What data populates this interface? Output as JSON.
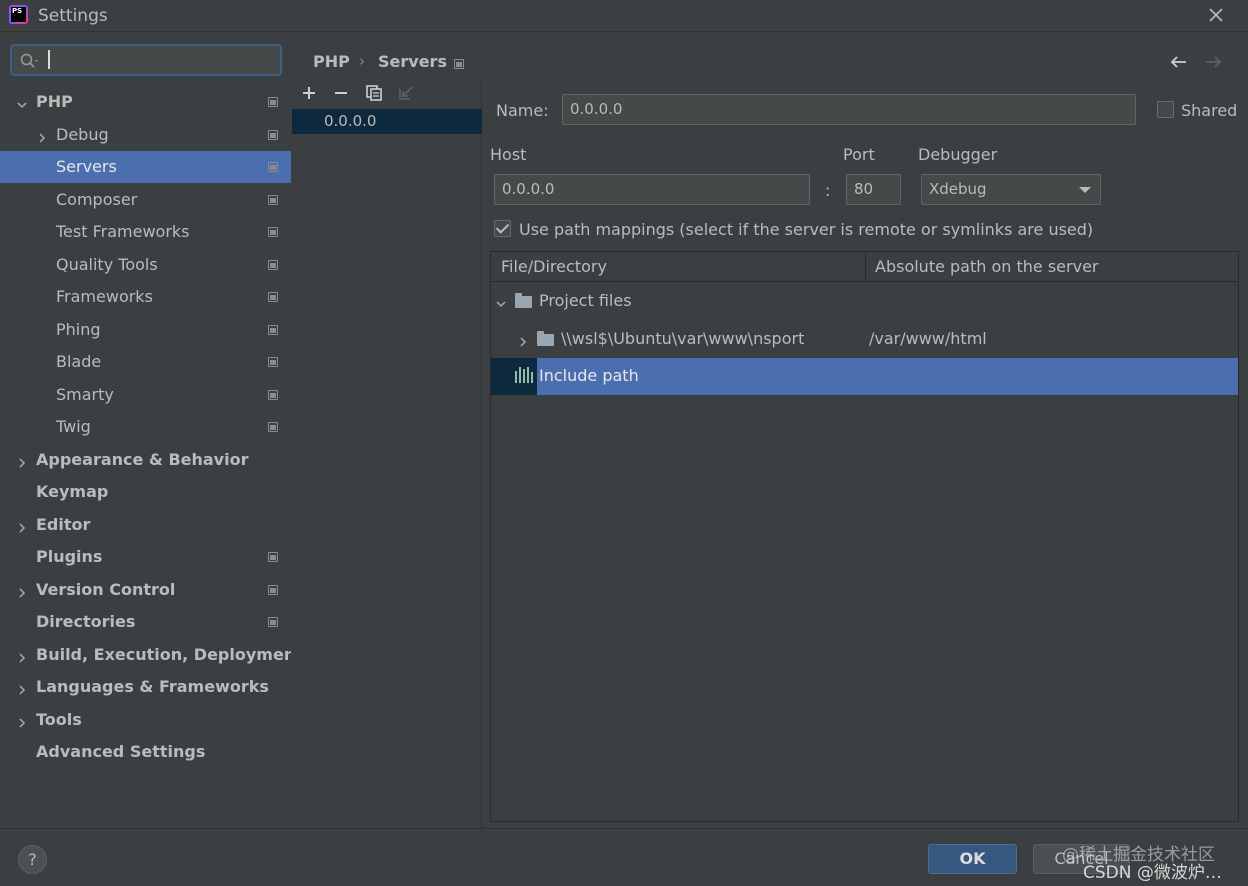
{
  "window": {
    "title": "Settings",
    "app_icon_text": "PS"
  },
  "search": {
    "value": "",
    "placeholder": ""
  },
  "sidebar": {
    "items": [
      {
        "label": "PHP",
        "bold": true,
        "expanded": true,
        "has_page_icon": true
      },
      {
        "label": "Debug",
        "bold": false,
        "expandable": true,
        "has_page_icon": true
      },
      {
        "label": "Servers",
        "bold": false,
        "selected": true,
        "has_page_icon": true
      },
      {
        "label": "Composer",
        "bold": false,
        "has_page_icon": true
      },
      {
        "label": "Test Frameworks",
        "bold": false,
        "has_page_icon": true
      },
      {
        "label": "Quality Tools",
        "bold": false,
        "has_page_icon": true
      },
      {
        "label": "Frameworks",
        "bold": false,
        "has_page_icon": true
      },
      {
        "label": "Phing",
        "bold": false,
        "has_page_icon": true
      },
      {
        "label": "Blade",
        "bold": false,
        "has_page_icon": true
      },
      {
        "label": "Smarty",
        "bold": false,
        "has_page_icon": true
      },
      {
        "label": "Twig",
        "bold": false,
        "has_page_icon": true
      },
      {
        "label": "Appearance & Behavior",
        "bold": true,
        "expandable": true
      },
      {
        "label": "Keymap",
        "bold": true
      },
      {
        "label": "Editor",
        "bold": true,
        "expandable": true
      },
      {
        "label": "Plugins",
        "bold": true,
        "has_page_icon": true
      },
      {
        "label": "Version Control",
        "bold": true,
        "expandable": true,
        "has_page_icon": true
      },
      {
        "label": "Directories",
        "bold": true,
        "has_page_icon": true
      },
      {
        "label": "Build, Execution, Deployment",
        "bold": true,
        "expandable": true
      },
      {
        "label": "Languages & Frameworks",
        "bold": true,
        "expandable": true
      },
      {
        "label": "Tools",
        "bold": true,
        "expandable": true
      },
      {
        "label": "Advanced Settings",
        "bold": true
      }
    ]
  },
  "breadcrumb": {
    "parent": "PHP",
    "separator": "›",
    "current": "Servers"
  },
  "servers": {
    "list": [
      "0.0.0.0"
    ]
  },
  "form": {
    "name_label": "Name:",
    "name_value": "0.0.0.0",
    "shared_label": "Shared",
    "shared_checked": false,
    "host_label": "Host",
    "host_value": "0.0.0.0",
    "port_separator": ":",
    "port_label": "Port",
    "port_value": "80",
    "debugger_label": "Debugger",
    "debugger_value": "Xdebug",
    "path_mappings_label": "Use path mappings (select if the server is remote or symlinks are used)",
    "path_mappings_checked": true
  },
  "mappings": {
    "col_file": "File/Directory",
    "col_server": "Absolute path on the server",
    "rows": {
      "project": {
        "label": "Project files"
      },
      "wsl": {
        "file": "\\\\wsl$\\Ubuntu\\var\\www\\nsport",
        "server": "/var/www/html"
      },
      "include": {
        "label": "Include path"
      }
    }
  },
  "buttons": {
    "ok": "OK",
    "cancel": "Cancel",
    "help": "?"
  },
  "watermark": {
    "line1": "@稀土掘金技术社区",
    "line2": "CSDN @微波炉…"
  },
  "colors": {
    "selection": "#4b6eaf",
    "background": "#3c3f41",
    "field": "#45494a",
    "ok_button": "#365880"
  }
}
